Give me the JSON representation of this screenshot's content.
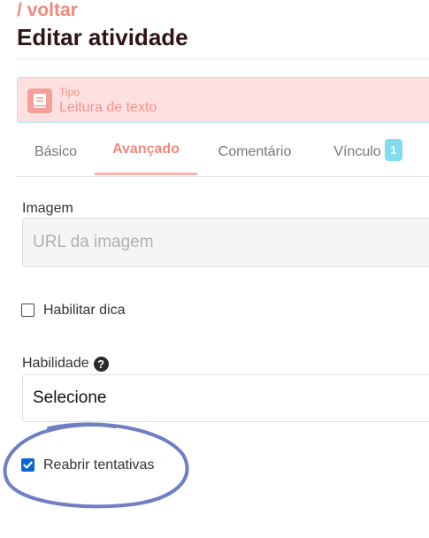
{
  "header": {
    "back_label": "/ voltar",
    "title": "Editar atividade"
  },
  "type_box": {
    "caption": "Tipo",
    "value": "Leitura de texto",
    "icon": "book-icon"
  },
  "tabs": [
    {
      "label": "Básico",
      "active": false
    },
    {
      "label": "Avançado",
      "active": true
    },
    {
      "label": "Comentário",
      "active": false
    },
    {
      "label": "Vínculo",
      "active": false,
      "badge": "1"
    }
  ],
  "image_field": {
    "label": "Imagem",
    "placeholder": "URL da imagem",
    "value": ""
  },
  "hint_checkbox": {
    "label": "Habilitar dica",
    "checked": false
  },
  "skill_field": {
    "label": "Habilidade",
    "help_icon": "question-circle-icon",
    "selected": "Selecione"
  },
  "reopen_checkbox": {
    "label": "Reabrir tentativas",
    "checked": true
  },
  "colors": {
    "accent": "#f08a7e",
    "title": "#2f1414",
    "type_bg": "#ffe0e0",
    "badge": "#82dcf0",
    "checkbox_checked": "#0a66d6",
    "annotation_stroke": "#6f7fc4"
  }
}
